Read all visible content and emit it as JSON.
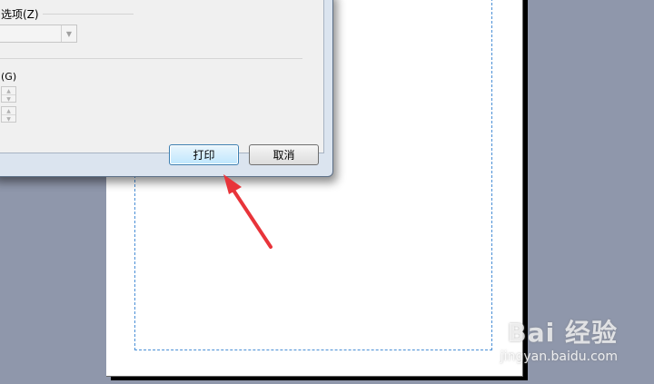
{
  "dialog": {
    "group_label": "选项(Z)",
    "group_label_visible": "选项(Z)",
    "combo_value": "",
    "g_label": "(G)",
    "print_button": "打印",
    "cancel_button": "取消"
  },
  "watermark": {
    "logo": "Bai 经验",
    "url": "jingyan.baidu.com"
  },
  "colors": {
    "background": "#8f97ab",
    "margin_guide": "#4a8fd6",
    "arrow": "#e8343a"
  }
}
